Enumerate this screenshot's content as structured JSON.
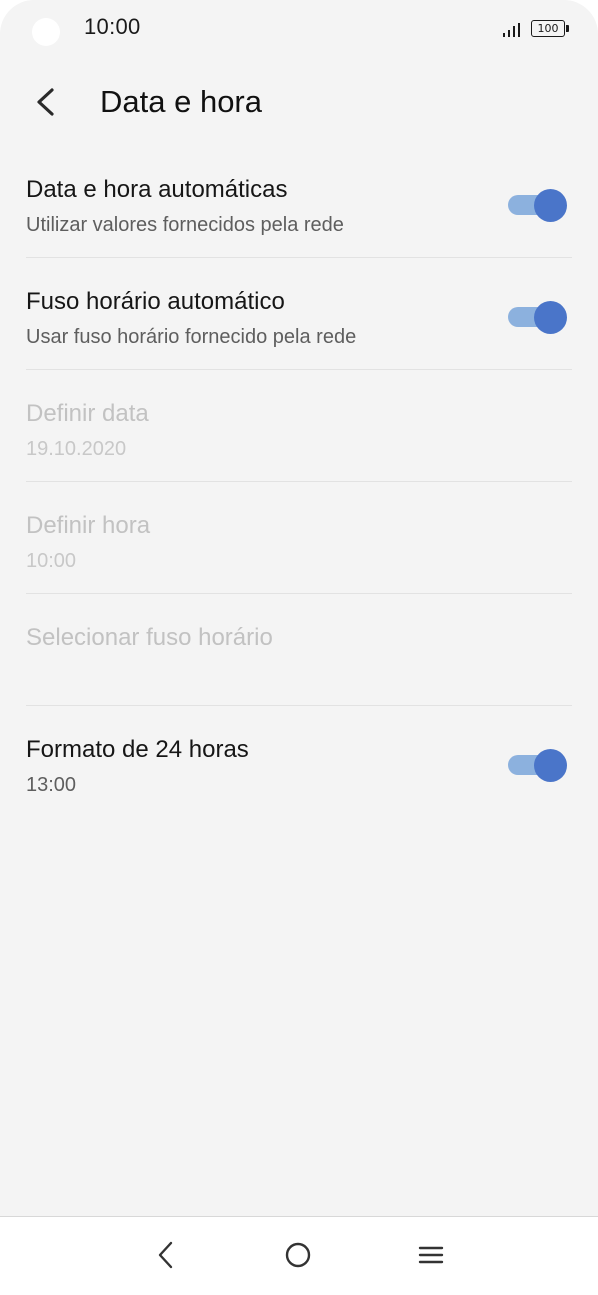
{
  "status_bar": {
    "time": "10:00",
    "battery": "100"
  },
  "header": {
    "title": "Data e hora",
    "back_icon": "chevron-left-icon"
  },
  "settings": [
    {
      "title": "Data e hora automáticas",
      "subtitle": "Utilizar valores fornecidos pela rede",
      "toggle": true,
      "enabled": true
    },
    {
      "title": "Fuso horário automático",
      "subtitle": "Usar fuso horário fornecido pela rede",
      "toggle": true,
      "enabled": true
    },
    {
      "title": "Definir data",
      "subtitle": "19.10.2020",
      "enabled": false
    },
    {
      "title": "Definir hora",
      "subtitle": "10:00",
      "enabled": false
    },
    {
      "title": "Selecionar fuso horário",
      "enabled": false
    },
    {
      "title": "Formato de 24 horas",
      "subtitle": "13:00",
      "toggle": true,
      "enabled": true
    }
  ],
  "nav_bar": {
    "back_icon": "nav-back-icon",
    "home_icon": "nav-home-icon",
    "menu_icon": "nav-menu-icon"
  },
  "colors": {
    "background": "#f4f4f4",
    "toggle_track": "#8cb1de",
    "toggle_thumb": "#4a75c9",
    "disabled_text": "#c2c2c2"
  }
}
